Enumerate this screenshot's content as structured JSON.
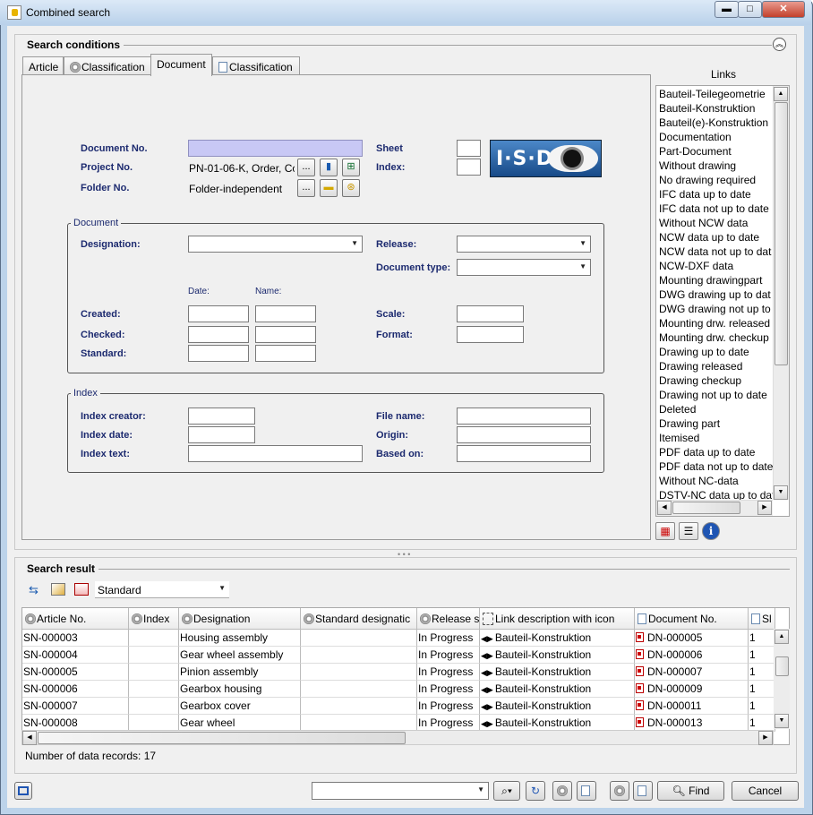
{
  "window": {
    "title": "Combined search",
    "min": "▬",
    "max": "□",
    "close": "✕"
  },
  "conditions": {
    "title": "Search conditions",
    "tabs": [
      "Article",
      "Classification",
      "Document",
      "Classification"
    ],
    "labels": {
      "doc_no": "Document No.",
      "project_no": "Project No.",
      "folder_no": "Folder No.",
      "sheet": "Sheet",
      "index": "Index:"
    },
    "project_value": "PN-01-06-K, Order, Co",
    "folder_value": "Folder-independent",
    "ellipsis": "...",
    "logo_text": "I·S·D",
    "document_group": {
      "legend": "Document",
      "designation": "Designation:",
      "release": "Release:",
      "doc_type": "Document type:",
      "date": "Date:",
      "name": "Name:",
      "created": "Created:",
      "checked": "Checked:",
      "standard": "Standard:",
      "scale": "Scale:",
      "format": "Format:"
    },
    "index_group": {
      "legend": "Index",
      "creator": "Index creator:",
      "date": "Index date:",
      "text": "Index text:",
      "file_name": "File name:",
      "origin": "Origin:",
      "based_on": "Based on:"
    }
  },
  "links": {
    "title": "Links",
    "items": [
      "Bauteil-Teilegeometrie",
      "Bauteil-Konstruktion",
      "Bauteil(e)-Konstruktion",
      "Documentation",
      "Part-Document",
      "Without drawing",
      "No drawing required",
      "IFC data up to date",
      "IFC data not up to date",
      "Without NCW data",
      "NCW data up to date",
      "NCW data not up to dat",
      "NCW-DXF data",
      "Mounting drawingpart",
      "DWG drawing up to dat",
      "DWG drawing not up to",
      "Mounting drw. released",
      "Mounting drw. checkup",
      "Drawing up to date",
      "Drawing released",
      "Drawing checkup",
      "Drawing not up to date",
      "Deleted",
      "Drawing part",
      "Itemised",
      "PDF data up to date",
      "PDF data not up to date",
      "Without NC-data",
      "DSTV-NC data up to dat"
    ],
    "icon_grid": "▦",
    "icon_list": "☰",
    "icon_info": "i"
  },
  "result": {
    "title": "Search result",
    "view": "Standard",
    "columns": [
      "Article No.",
      "Index",
      "Designation",
      "Standard designatic",
      "Release s",
      "Link description with icon",
      "Document No.",
      "Sl"
    ],
    "rows": [
      {
        "article": "SN-000003",
        "index": "",
        "designation": "Housing assembly",
        "std": "",
        "release": "In Progress",
        "link": "Bauteil-Konstruktion",
        "doc": "DN-000005",
        "sheet": "1"
      },
      {
        "article": "SN-000004",
        "index": "",
        "designation": "Gear wheel assembly",
        "std": "",
        "release": "In Progress",
        "link": "Bauteil-Konstruktion",
        "doc": "DN-000006",
        "sheet": "1"
      },
      {
        "article": "SN-000005",
        "index": "",
        "designation": "Pinion assembly",
        "std": "",
        "release": "In Progress",
        "link": "Bauteil-Konstruktion",
        "doc": "DN-000007",
        "sheet": "1"
      },
      {
        "article": "SN-000006",
        "index": "",
        "designation": "Gearbox housing",
        "std": "",
        "release": "In Progress",
        "link": "Bauteil-Konstruktion",
        "doc": "DN-000009",
        "sheet": "1"
      },
      {
        "article": "SN-000007",
        "index": "",
        "designation": "Gearbox cover",
        "std": "",
        "release": "In Progress",
        "link": "Bauteil-Konstruktion",
        "doc": "DN-000011",
        "sheet": "1"
      },
      {
        "article": "SN-000008",
        "index": "",
        "designation": "Gear wheel",
        "std": "",
        "release": "In Progress",
        "link": "Bauteil-Konstruktion",
        "doc": "DN-000013",
        "sheet": "1"
      }
    ],
    "records": "Number of data records: 17"
  },
  "footer": {
    "find": "Find",
    "cancel": "Cancel"
  }
}
